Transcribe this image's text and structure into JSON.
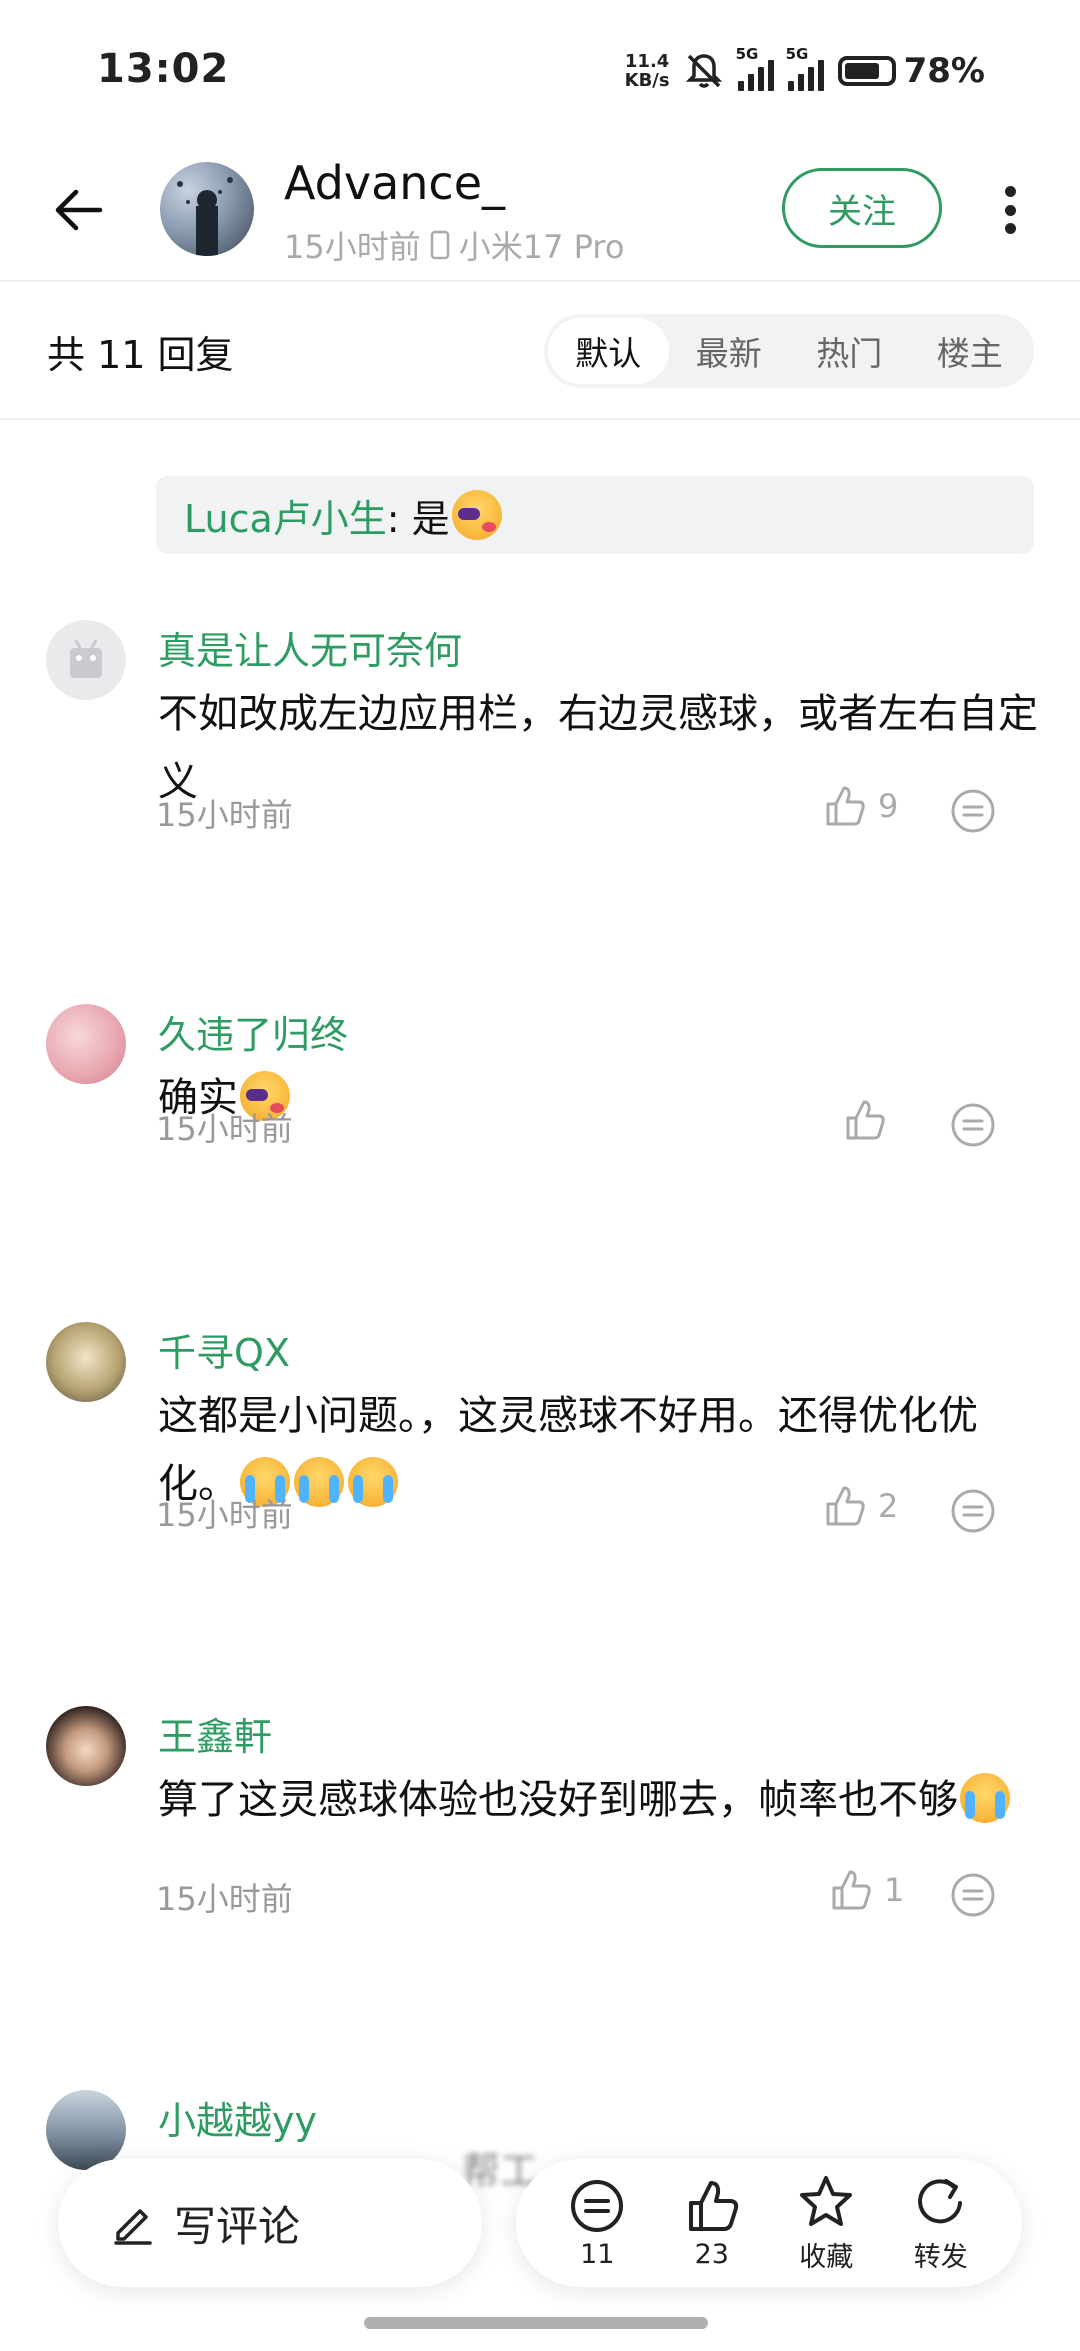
{
  "status_bar": {
    "time": "13:02",
    "net_speed_value": "11.4",
    "net_speed_unit": "KB/s",
    "signal1_label": "5G",
    "signal2_label": "5G",
    "battery_percent": "78%",
    "battery_level": 0.78
  },
  "header": {
    "author_name": "Advance_",
    "post_time": "15小时前",
    "device": "小米17 Pro",
    "follow_label": "关注"
  },
  "replies": {
    "count_label": "共 11 回复",
    "sort_tabs": [
      {
        "label": "默认",
        "active": true
      },
      {
        "label": "最新",
        "active": false
      },
      {
        "label": "热门",
        "active": false
      },
      {
        "label": "楼主",
        "active": false
      }
    ]
  },
  "quote": {
    "user": "Luca卢小生",
    "text": ": 是"
  },
  "comments": [
    {
      "name": "真是让人无可奈何",
      "text": "不如改成左边应用栏，右边灵感球，或者左右自定义",
      "time": "15小时前",
      "likes": "9"
    },
    {
      "name": "久违了归终",
      "text": "确实",
      "time": "15小时前",
      "likes": ""
    },
    {
      "name": "千寻QX",
      "text": "这都是小问题。，这灵感球不好用。还得优化优化。",
      "time": "15小时前",
      "likes": "2"
    },
    {
      "name": "王鑫軒",
      "text": "算了这灵感球体验也没好到哪去，帧率也不够",
      "time": "15小时前",
      "likes": "1"
    },
    {
      "name": "小越越yy"
    }
  ],
  "bottom_bar": {
    "write_comment": "写评论",
    "comments_count": "11",
    "likes_count": "23",
    "favorite_label": "收藏",
    "share_label": "转发",
    "behind_text": "帮工"
  },
  "colors": {
    "accent_green": "#2e9b62",
    "muted_gray": "#999999",
    "tab_bg": "#f1f2f4"
  }
}
